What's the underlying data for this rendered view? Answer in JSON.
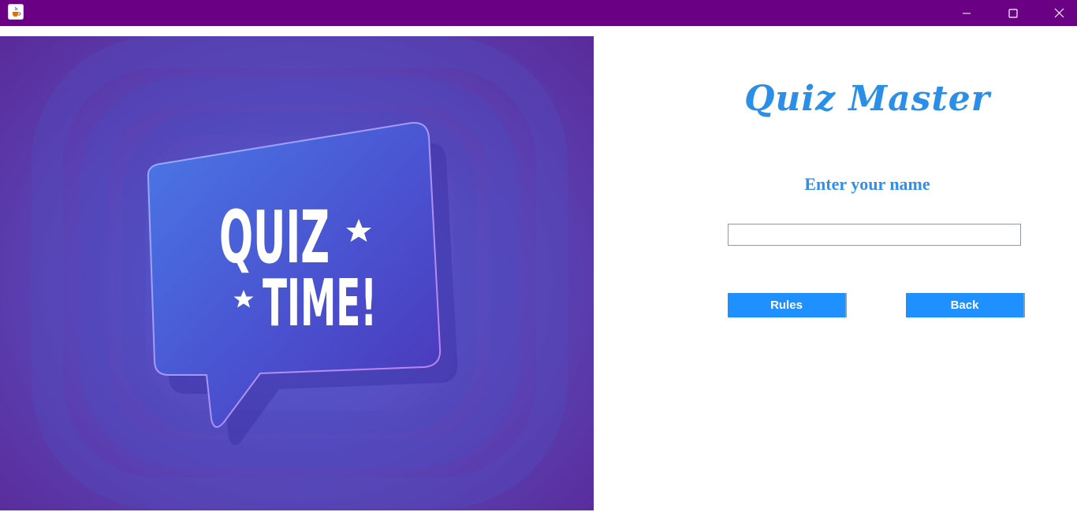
{
  "window": {
    "app_icon": "java-cup-icon",
    "controls": [
      "minimize-icon",
      "maximize-icon",
      "close-icon"
    ],
    "titlebar_color": "#6a0084"
  },
  "banner": {
    "line1": "QUIZ",
    "line2": "TIME!"
  },
  "form": {
    "app_title": "Quiz Master",
    "name_label": "Enter your name",
    "name_value": "",
    "accent_color": "#1e90ff",
    "buttons": {
      "rules": "Rules",
      "back": "Back"
    }
  }
}
